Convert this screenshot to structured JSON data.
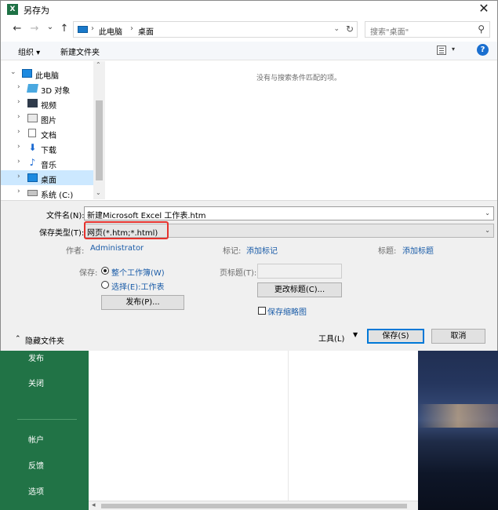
{
  "background": {
    "menu_items": [
      "发布",
      "关闭",
      "帐户",
      "反馈",
      "选项"
    ]
  },
  "dialog": {
    "title": "另存为",
    "title_icon": "excel-icon",
    "close_symbol": "✕",
    "nav": {
      "back": "←",
      "forward": "→",
      "recent": "⌄",
      "up": "↑"
    },
    "address": {
      "crumbs": [
        "此电脑",
        "桌面"
      ],
      "separator": "›",
      "refresh": "↻"
    },
    "search": {
      "placeholder": "搜索\"桌面\"",
      "icon": "⚲"
    },
    "toolbar": {
      "organize": "组织 ▾",
      "new_folder": "新建文件夹",
      "help": "?"
    },
    "tree": [
      {
        "label": "此电脑",
        "expanded": true,
        "icon": "computer-icon"
      },
      {
        "label": "3D 对象",
        "icon": "3d-objects-icon"
      },
      {
        "label": "视频",
        "icon": "video-icon"
      },
      {
        "label": "图片",
        "icon": "pictures-icon"
      },
      {
        "label": "文档",
        "icon": "documents-icon"
      },
      {
        "label": "下载",
        "icon": "download-icon"
      },
      {
        "label": "音乐",
        "icon": "music-icon"
      },
      {
        "label": "桌面",
        "selected": true,
        "icon": "desktop-icon"
      },
      {
        "label": "系统 (C:)",
        "icon": "drive-icon"
      }
    ],
    "empty_message": "没有与搜索条件匹配的项。",
    "form": {
      "filename_label": "文件名(N):",
      "filename_value": "新建Microsoft Excel 工作表.htm",
      "filetype_label": "保存类型(T):",
      "filetype_value": "网页(*.htm;*.html)",
      "author_label": "作者:",
      "author_value": "Administrator",
      "tags_label": "标记:",
      "tags_value": "添加标记",
      "title_label": "标题:",
      "title_value": "添加标题",
      "save_label": "保存:",
      "radio_workbook": "整个工作簿(W)",
      "radio_sheet": "选择(E):工作表",
      "publish_button": "发布(P)...",
      "page_title_label": "页标题(T):",
      "change_title_button": "更改标题(C)...",
      "thumbnail_label": "保存缩略图",
      "hide_folders": "隐藏文件夹",
      "tools_button": "工具(L)",
      "save_button": "保存(S)",
      "cancel_button": "取消"
    }
  }
}
